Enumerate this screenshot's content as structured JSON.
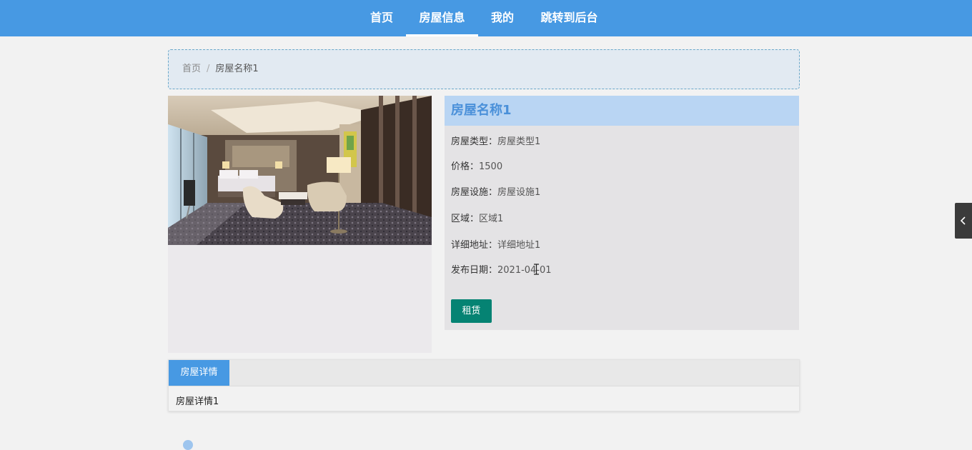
{
  "nav": {
    "items": [
      {
        "label": "首页",
        "active": false
      },
      {
        "label": "房屋信息",
        "active": true
      },
      {
        "label": "我的",
        "active": false
      },
      {
        "label": "跳转到后台",
        "active": false
      }
    ]
  },
  "breadcrumb": {
    "home": "首页",
    "separator": "/",
    "current": "房屋名称1"
  },
  "house": {
    "title": "房屋名称1",
    "fields": [
      {
        "label": "房屋类型：",
        "value": "房屋类型1"
      },
      {
        "label": "价格：",
        "value": "1500"
      },
      {
        "label": "房屋设施：",
        "value": "房屋设施1"
      },
      {
        "label": "区域：",
        "value": "区域1"
      },
      {
        "label": "详细地址：",
        "value": "详细地址1"
      },
      {
        "label": "发布日期：",
        "value": "2021-04-01"
      }
    ],
    "rent_button": "租赁"
  },
  "details": {
    "tab_label": "房屋详情",
    "content": "房屋详情1"
  },
  "colors": {
    "nav_bg": "#4799e3",
    "title_bg": "#b9d5f3",
    "title_text": "#4a90d9",
    "rent_button_bg": "#058373"
  },
  "icons": {
    "side_toggle": "chevron-left-icon"
  }
}
